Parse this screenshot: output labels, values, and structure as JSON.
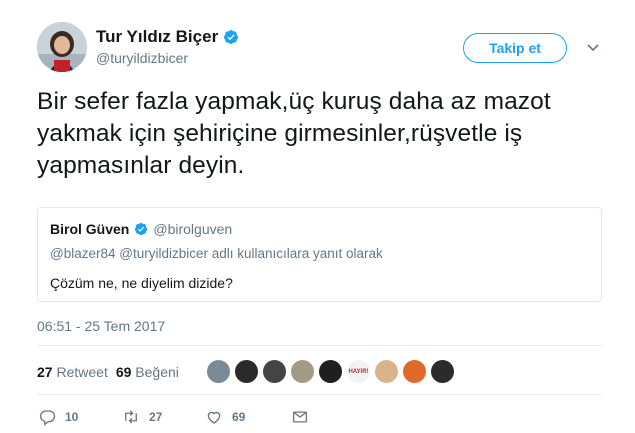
{
  "author": {
    "name": "Tur Yıldız Biçer",
    "handle": "@turyildizbicer"
  },
  "follow_label": "Takip et",
  "tweet_text": "Bir sefer fazla yapmak,üç kuruş daha az mazot yakmak için şehiriçine girmesinler,rüşvetle iş yapmasınlar deyin.",
  "quoted": {
    "name": "Birol Güven",
    "handle": "@birolguven",
    "reply_to": "@blazer84 @turyildizbicer adlı kullanıcılara yanıt olarak",
    "text": "Çözüm ne, ne diyelim dizide?"
  },
  "timestamp": "06:51 - 25 Tem 2017",
  "stats": {
    "retweet_count": "27",
    "retweet_label": "Retweet",
    "like_count": "69",
    "like_label": "Beğeni"
  },
  "likers": [
    {
      "icon": "avatar-landscape",
      "color": "#7a8a96"
    },
    {
      "icon": "avatar-woman",
      "color": "#2a2a2a"
    },
    {
      "icon": "avatar-bw-pattern",
      "color": "#444444"
    },
    {
      "icon": "avatar-man",
      "color": "#a39a86"
    },
    {
      "icon": "avatar-dark",
      "color": "#1f1f1f"
    },
    {
      "icon": "avatar-text",
      "color": "#f2f2f2",
      "text": "HAYIR!"
    },
    {
      "icon": "avatar-blonde",
      "color": "#d9b38c"
    },
    {
      "icon": "avatar-orange",
      "color": "#e06a2c"
    },
    {
      "icon": "avatar-dark-2",
      "color": "#2b2b2b"
    }
  ],
  "actions": {
    "reply_count": "10",
    "retweet_count": "27",
    "like_count": "69"
  },
  "colors": {
    "accent": "#1da1f2",
    "secondary_text": "#657786",
    "border": "#e1e8ed"
  }
}
